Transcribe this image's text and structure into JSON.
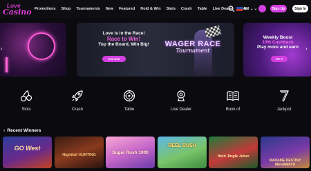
{
  "logo": {
    "line1": "Love",
    "line2": "Casino"
  },
  "nav": {
    "items": [
      "Promotions",
      "Shop",
      "Tournaments",
      "New",
      "Featured",
      "Hold & Win",
      "Slots",
      "Crash",
      "Table",
      "Live Dealer",
      "More"
    ],
    "more_chevron": "⌄",
    "language": "EN",
    "signup": "Sign Up",
    "signin": "Sign In"
  },
  "banners": {
    "main": {
      "line1": "Love is in the Race!",
      "line2": "Race to Win!",
      "line3": "Top the Board, Win Big!",
      "button": "JOIN NOW",
      "logo_line1": "WAGER RACE",
      "logo_line2": "Tournament"
    },
    "right": {
      "line1": "Weekly Boost",
      "line2": "10% Cashback",
      "line3": "Play more and earn",
      "button": "TRY IT"
    },
    "arrow_left": "‹",
    "arrow_right": "›"
  },
  "categories": [
    {
      "label": "Slots",
      "icon": "cherries-icon"
    },
    {
      "label": "Crash",
      "icon": "rocket-icon"
    },
    {
      "label": "Table",
      "icon": "roulette-icon"
    },
    {
      "label": "Live Dealer",
      "icon": "dealer-icon"
    },
    {
      "label": "Book of",
      "icon": "book-icon"
    },
    {
      "label": "Jackpot",
      "icon": "seven-icon"
    }
  ],
  "recent_winners": {
    "title": "Recent Winners",
    "games": [
      {
        "title": "GO West"
      },
      {
        "title": "Nightfall HUNTING"
      },
      {
        "title": "Sugar Rush 1000"
      },
      {
        "title": "REEL RUSH"
      },
      {
        "title": "Hold Jingle Joker"
      },
      {
        "title": "MADAME DESTINY MEGAWAYS"
      }
    ]
  },
  "colors": {
    "accent": "#d23fe0",
    "background": "#0b0b0f"
  }
}
